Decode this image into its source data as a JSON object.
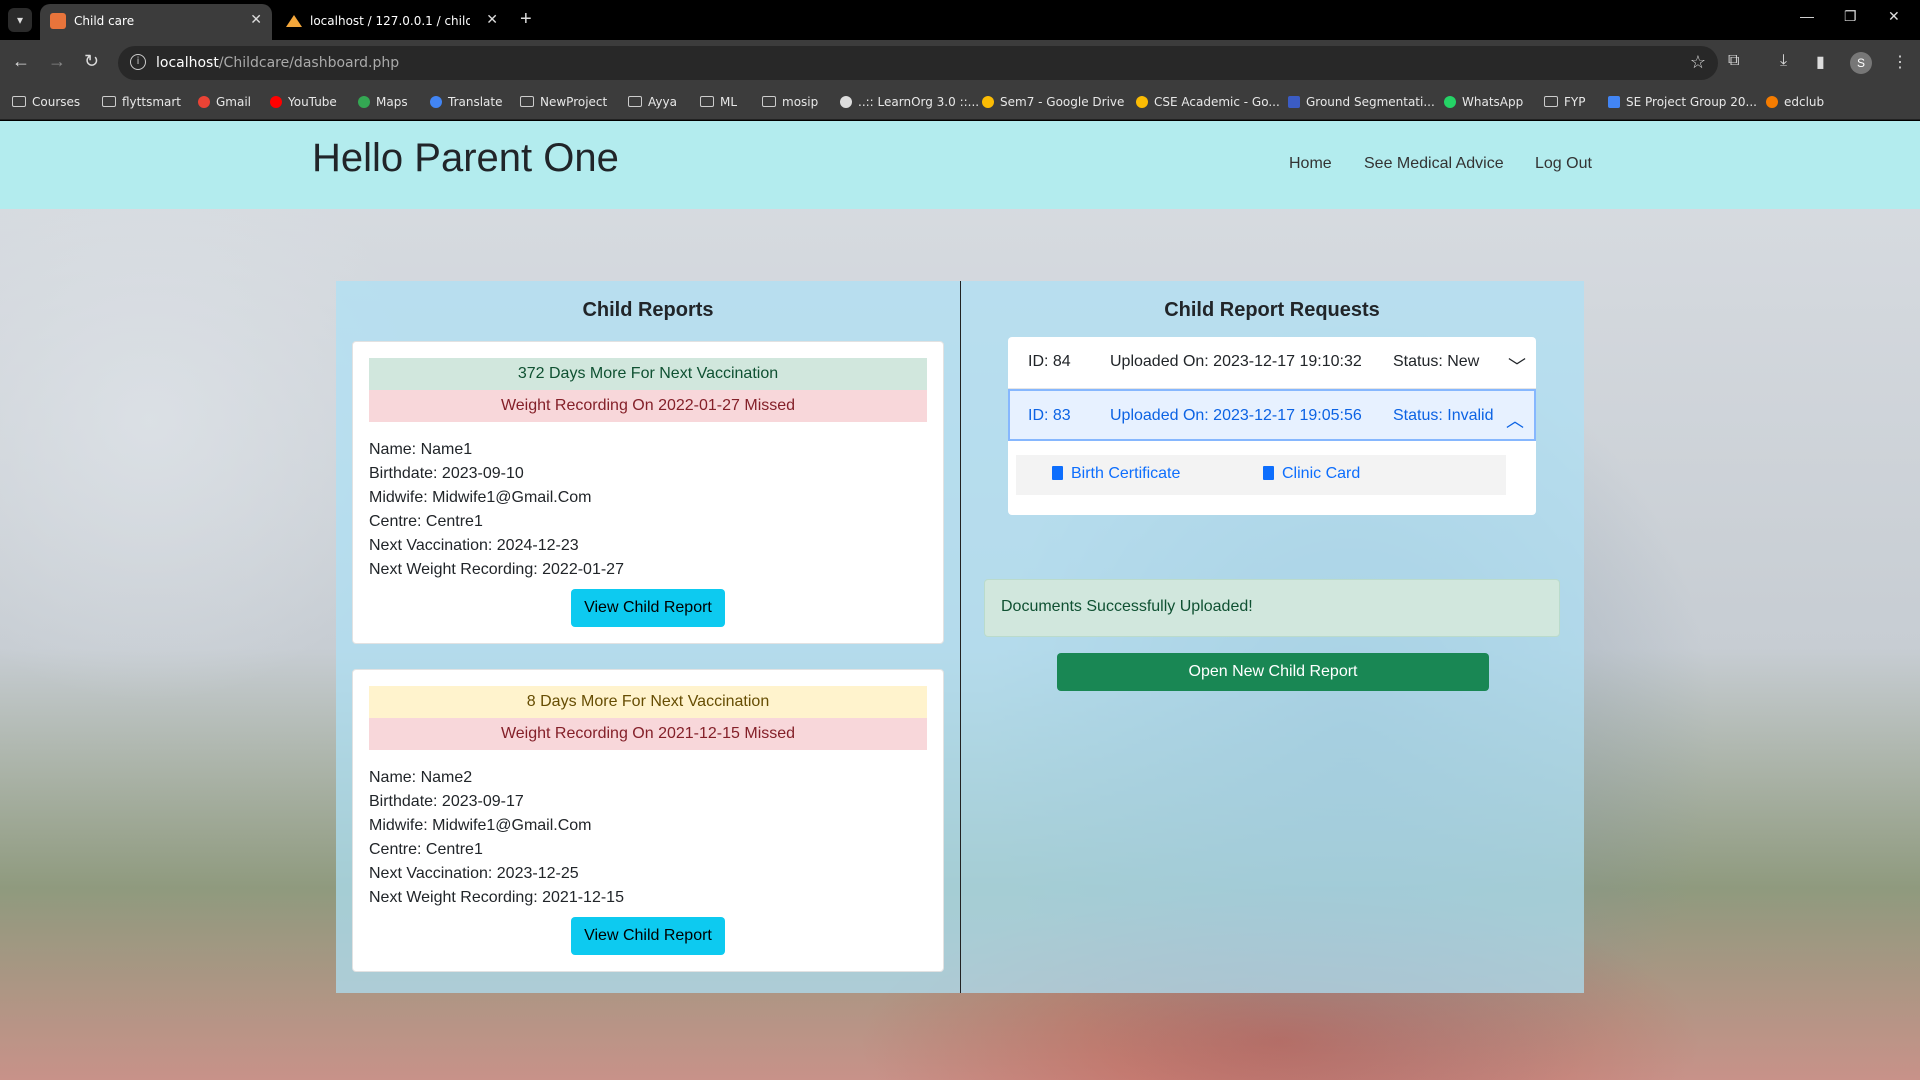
{
  "browser": {
    "tabs": [
      {
        "title": "Child care",
        "active": true
      },
      {
        "title": "localhost / 127.0.0.1 / child_care",
        "active": false
      }
    ],
    "url_host": "localhost",
    "url_path": "/Childcare/dashboard.php",
    "profile_initial": "S",
    "bookmarks": [
      "Courses",
      "flyttsmart",
      "Gmail",
      "YouTube",
      "Maps",
      "Translate",
      "NewProject",
      "Ayya",
      "ML",
      "mosip",
      "..:: LearnOrg 3.0 ::...",
      "Sem7 - Google Drive",
      "CSE Academic - Go...",
      "Ground Segmentati...",
      "WhatsApp",
      "FYP",
      "SE Project Group 20...",
      "edclub"
    ]
  },
  "header": {
    "greeting": "Hello Parent One",
    "nav": [
      "Home",
      "See Medical Advice",
      "Log Out"
    ]
  },
  "child_reports": {
    "title": "Child Reports",
    "cards": [
      {
        "vaccination_alert": "372 Days More For Next Vaccination",
        "vaccination_alert_color": "#d1e7dd",
        "weight_alert": "Weight Recording On 2022-01-27 Missed",
        "name": "Name: Name1",
        "birthdate": "Birthdate: 2023-09-10",
        "midwife": "Midwife: Midwife1@Gmail.Com",
        "centre": "Centre: Centre1",
        "next_vaccination": "Next Vaccination: 2024-12-23",
        "next_weight": "Next Weight Recording: 2022-01-27",
        "button": "View Child Report"
      },
      {
        "vaccination_alert": "8 Days More For Next Vaccination",
        "vaccination_alert_color": "#fff3cd",
        "weight_alert": "Weight Recording On 2021-12-15 Missed",
        "name": "Name: Name2",
        "birthdate": "Birthdate: 2023-09-17",
        "midwife": "Midwife: Midwife1@Gmail.Com",
        "centre": "Centre: Centre1",
        "next_vaccination": "Next Vaccination: 2023-12-25",
        "next_weight": "Next Weight Recording: 2021-12-15",
        "button": "View Child Report"
      }
    ]
  },
  "requests": {
    "title": "Child Report Requests",
    "items": [
      {
        "id": "ID: 84",
        "uploaded": "Uploaded On: 2023-12-17 19:10:32",
        "status": "Status: New",
        "expanded": false
      },
      {
        "id": "ID: 83",
        "uploaded": "Uploaded On: 2023-12-17 19:05:56",
        "status": "Status: Invalid",
        "expanded": true
      }
    ],
    "documents": [
      "Birth Certificate",
      "Clinic Card"
    ],
    "success_message": "Documents Successfully Uploaded!",
    "open_button": "Open New Child Report"
  }
}
